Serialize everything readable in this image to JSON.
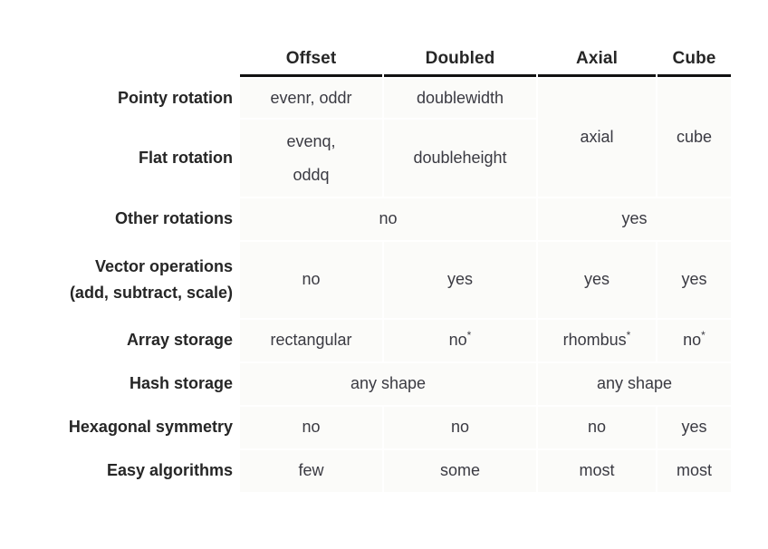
{
  "table": {
    "columns": [
      {
        "key": "label",
        "label": ""
      },
      {
        "key": "offset",
        "label": "Offset"
      },
      {
        "key": "doubled",
        "label": "Doubled"
      },
      {
        "key": "axial",
        "label": "Axial"
      },
      {
        "key": "cube",
        "label": "Cube"
      }
    ],
    "rows": [
      {
        "id": "pointy-rotation",
        "label": "Pointy rotation",
        "offset": "evenr, oddr",
        "doubled": "doublewidth",
        "axial": "axial",
        "cube": "cube"
      },
      {
        "id": "flat-rotation",
        "label": "Flat rotation",
        "offset": "evenq,\noddq",
        "doubled": "doubleheight",
        "axial": "",
        "cube": ""
      },
      {
        "id": "other-rotations",
        "label": "Other rotations",
        "offset_doubled": "no",
        "axial_cube": "yes"
      },
      {
        "id": "vector-operations",
        "label": "Vector operations\n(add, subtract, scale)",
        "offset": "no",
        "doubled": "yes",
        "axial": "yes",
        "cube": "yes"
      },
      {
        "id": "array-storage",
        "label": "Array storage",
        "offset": "rectangular",
        "doubled": "no",
        "doubled_star": "*",
        "axial": "rhombus",
        "axial_star": "*",
        "cube": "no",
        "cube_star": "*"
      },
      {
        "id": "hash-storage",
        "label": "Hash storage",
        "offset_doubled": "any shape",
        "axial_cube": "any shape"
      },
      {
        "id": "hexagonal-symmetry",
        "label": "Hexagonal symmetry",
        "offset": "no",
        "doubled": "no",
        "axial": "no",
        "cube": "yes"
      },
      {
        "id": "easy-algorithms",
        "label": "Easy algorithms",
        "offset": "few",
        "doubled": "some",
        "axial": "most",
        "cube": "most"
      }
    ]
  },
  "colors": {
    "page_background": "#ffffff",
    "cell_background": "#fbfbf9",
    "header_text": "#262626",
    "cell_text": "#3a3a42",
    "header_rule": "#111111"
  }
}
